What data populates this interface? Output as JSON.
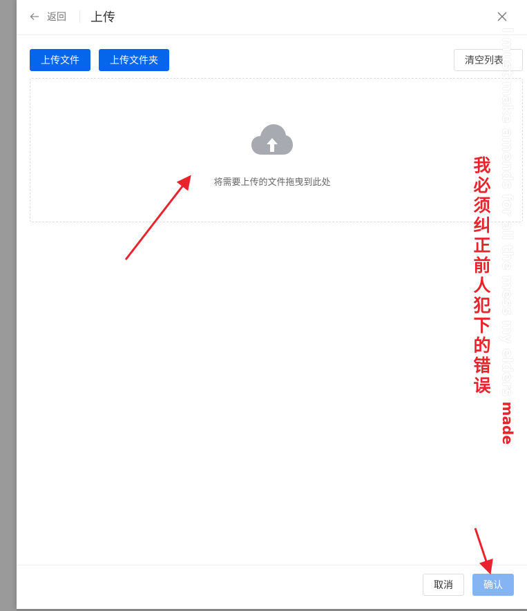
{
  "header": {
    "back_label": "返回",
    "title": "上传"
  },
  "toolbar": {
    "upload_file_label": "上传文件",
    "upload_folder_label": "上传文件夹",
    "clear_list_label": "清空列表"
  },
  "dropzone": {
    "hint": "将需要上传的文件拖曳到此处"
  },
  "footer": {
    "cancel_label": "取消",
    "confirm_label": "确认"
  },
  "annotations": {
    "chinese_note": "我必须纠正前人犯下的错误",
    "english_note_ghost": "I must make amends for all the mess my elders ",
    "english_note_red": "made"
  },
  "colors": {
    "primary": "#0666eb",
    "confirm_disabled": "#84b4f4",
    "annotation_red": "#e8232c"
  },
  "icons": [
    "arrow-left-icon",
    "close-icon",
    "cloud-upload-icon"
  ]
}
